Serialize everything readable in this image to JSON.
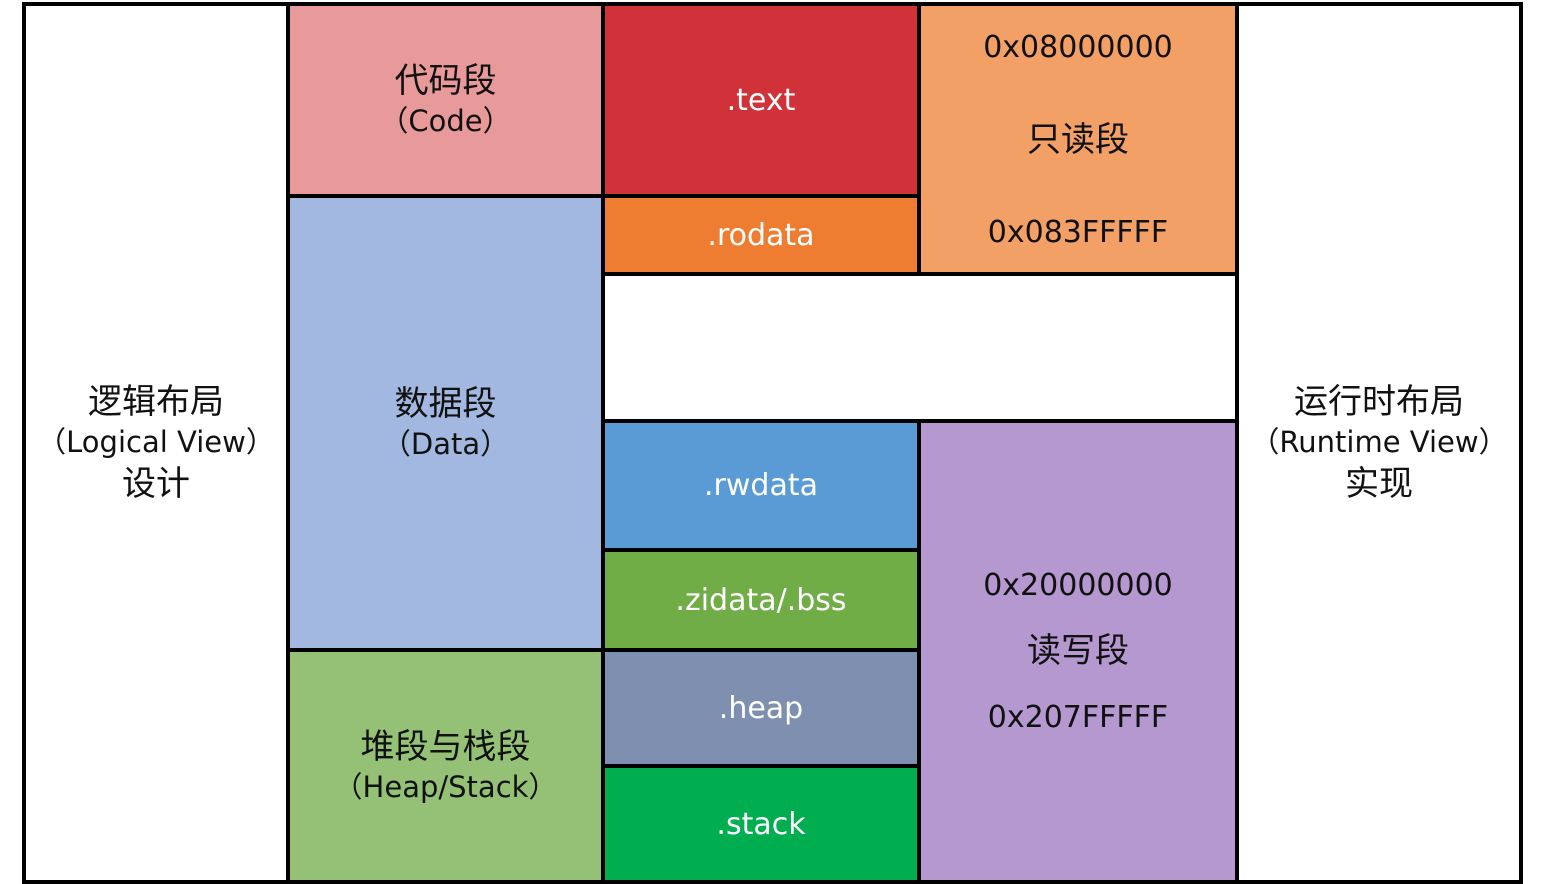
{
  "left_panel": {
    "line1": "逻辑布局",
    "line2": "（Logical View）",
    "line3": "设计"
  },
  "right_panel": {
    "line1": "运行时布局",
    "line2": "（Runtime View）",
    "line3": "实现"
  },
  "logical": {
    "code": {
      "title": "代码段",
      "subtitle": "（Code）",
      "color": "#E89A9B"
    },
    "data": {
      "title": "数据段",
      "subtitle": "（Data）",
      "color": "#A2B8E0"
    },
    "heapstack": {
      "title": "堆段与栈段",
      "subtitle": "（Heap/Stack）",
      "color": "#95C177"
    }
  },
  "sections": {
    "text": {
      "label": ".text",
      "color": "#D13239"
    },
    "rodata": {
      "label": ".rodata",
      "color": "#EE7D31"
    },
    "gap": {
      "label": "",
      "color": "#FFFFFF"
    },
    "rwdata": {
      "label": ".rwdata",
      "color": "#5B9BD5"
    },
    "zidata": {
      "label": ".zidata/.bss",
      "color": "#70AD47"
    },
    "heap": {
      "label": ".heap",
      "color": "#7F8FAF"
    },
    "stack": {
      "label": ".stack",
      "color": "#00AE50"
    }
  },
  "regions": {
    "readonly": {
      "start": "0x08000000",
      "name": "只读段",
      "end": "0x083FFFFF",
      "color": "#F2A066"
    },
    "readwrite": {
      "start": "0x20000000",
      "name": "读写段",
      "end": "0x207FFFFF",
      "color": "#B498CF"
    }
  }
}
